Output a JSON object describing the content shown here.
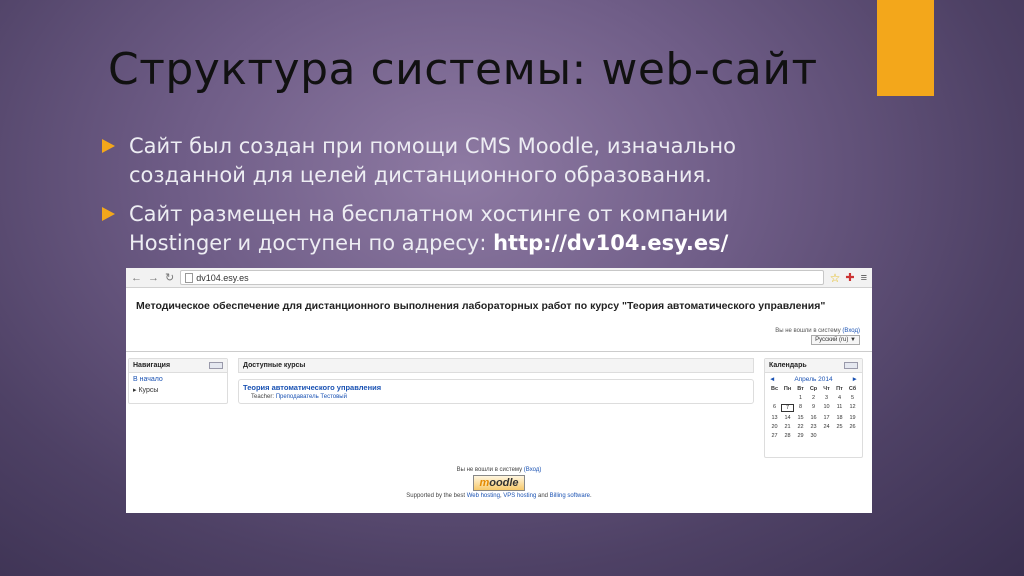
{
  "slide": {
    "title": "Структура системы: web-сайт",
    "bullets": [
      {
        "text": "Сайт был создан при помощи CMS Moodle, изначально созданной для целей дистанционного образования."
      },
      {
        "text_before": "Сайт размещен на бесплатном хостинге от компании Hostinger и доступен по адресу: ",
        "link": "http://dv104.esy.es/"
      }
    ],
    "accent_color": "#f3a71b"
  },
  "browser": {
    "url": "dv104.esy.es",
    "icons": [
      "back-icon",
      "forward-icon",
      "reload-icon",
      "star-icon",
      "extension-icon",
      "menu-icon"
    ]
  },
  "site": {
    "header_title": "Методическое обеспечение для дистанционного выполнения лабораторных работ по курсу \"Теория автоматического управления\"",
    "login_text": "Вы не вошли в систему",
    "login_link": "(Вход)",
    "language": "Русский (ru) ▼",
    "nav_block": {
      "title": "Навигация",
      "home": "В начало",
      "courses": "Курсы"
    },
    "courses_block": {
      "title": "Доступные курсы",
      "course_name": "Теория автоматического управления",
      "teacher_label": "Teacher:",
      "teacher_name": "Преподаватель Тестовый"
    },
    "calendar": {
      "title": "Календарь",
      "month": "Апрель 2014",
      "prev": "◄",
      "next": "►",
      "weekdays": [
        "Вс",
        "Пн",
        "Вт",
        "Ср",
        "Чт",
        "Пт",
        "Сб"
      ],
      "weeks": [
        [
          "",
          "",
          "1",
          "2",
          "3",
          "4",
          "5"
        ],
        [
          "6",
          "7",
          "8",
          "9",
          "10",
          "11",
          "12"
        ],
        [
          "13",
          "14",
          "15",
          "16",
          "17",
          "18",
          "19"
        ],
        [
          "20",
          "21",
          "22",
          "23",
          "24",
          "25",
          "26"
        ],
        [
          "27",
          "28",
          "29",
          "30",
          "",
          "",
          ""
        ]
      ],
      "today": "7"
    },
    "footer": {
      "login_text": "Вы не вошли в систему",
      "login_link": "(Вход)",
      "logo_text": "moodle",
      "supported_by": "Supported by the best",
      "web_hosting": "Web hosting",
      "vps_hosting": "VPS hosting",
      "and": "and",
      "billing": "Billing software",
      "end": "."
    }
  }
}
